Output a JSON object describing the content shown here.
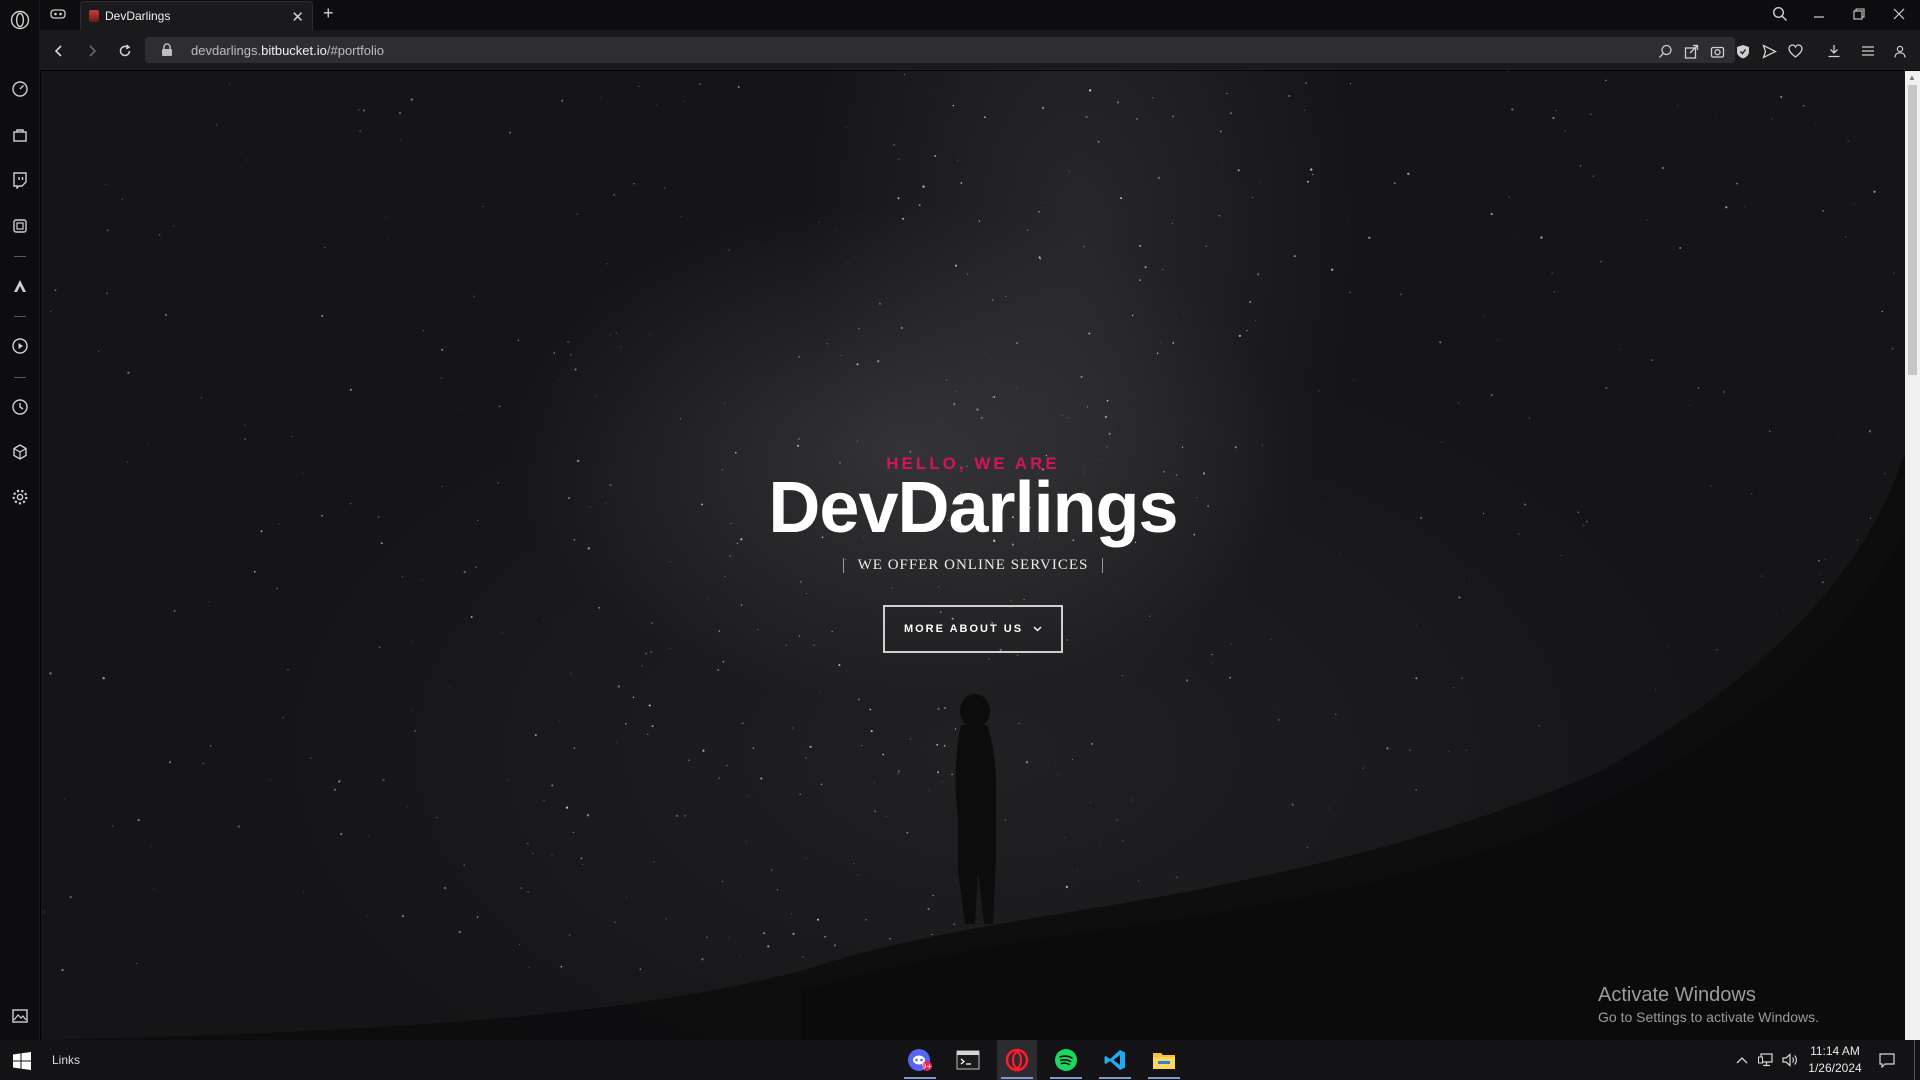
{
  "browser": {
    "tab_title": "DevDarlings",
    "new_tab_label": "+",
    "url_host_prefix": "devdarlings.",
    "url_host": "bitbucket.io",
    "url_path": "/#portfolio"
  },
  "hero": {
    "eyebrow": "HELLO, WE ARE",
    "title": "DevDarlings",
    "tagline": "WE OFFER ONLINE SERVICES",
    "cta_label": "MORE ABOUT US",
    "accent_color": "#d4145a"
  },
  "watermark": {
    "line1": "Activate Windows",
    "line2": "Go to Settings to activate Windows."
  },
  "taskbar": {
    "links_label": "Links",
    "time": "11:14 AM",
    "date": "1/26/2024",
    "apps": [
      "discord-icon",
      "terminal-icon",
      "opera-icon",
      "spotify-icon",
      "vscode-icon",
      "file-explorer-icon"
    ]
  },
  "sidebar": {
    "items": [
      "speed-dial-icon",
      "shopping-icon",
      "twitch-icon",
      "music-player-icon",
      "aria-icon",
      "player-icon",
      "history-icon",
      "extensions-icon",
      "settings-icon",
      "wallpaper-icon"
    ]
  }
}
